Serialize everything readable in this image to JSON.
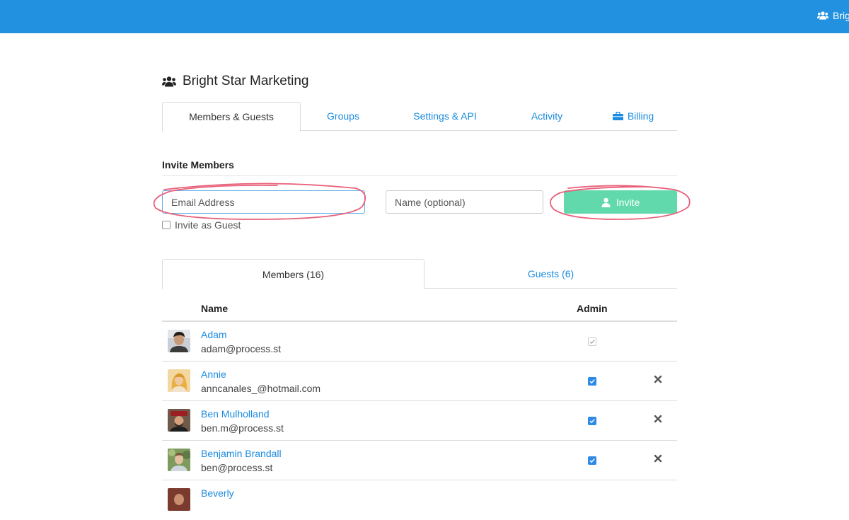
{
  "topbar": {
    "org_label": "Brig",
    "icon": "users-icon"
  },
  "org": {
    "title": "Bright Star Marketing",
    "icon": "users-icon"
  },
  "tabs": [
    {
      "label": "Members & Guests",
      "active": true
    },
    {
      "label": "Groups"
    },
    {
      "label": "Settings & API"
    },
    {
      "label": "Activity"
    },
    {
      "label": "Billing",
      "icon": "briefcase-icon"
    }
  ],
  "invite": {
    "title": "Invite Members",
    "email_placeholder": "Email Address",
    "name_placeholder": "Name (optional)",
    "button_label": "Invite",
    "button_icon": "user-icon",
    "guest_label": "Invite as Guest"
  },
  "subtabs": [
    {
      "label": "Members (16)",
      "active": true
    },
    {
      "label": "Guests (6)"
    }
  ],
  "table": {
    "headers": {
      "name": "Name",
      "admin": "Admin"
    },
    "rows": [
      {
        "name": "Adam",
        "email": "adam@process.st",
        "admin": true,
        "admin_disabled": true,
        "removable": false
      },
      {
        "name": "Annie",
        "email": "anncanales_@hotmail.com",
        "admin": true,
        "removable": true
      },
      {
        "name": "Ben Mulholland",
        "email": "ben.m@process.st",
        "admin": true,
        "removable": true
      },
      {
        "name": "Benjamin Brandall",
        "email": "ben@process.st",
        "admin": true,
        "removable": true
      },
      {
        "name": "Beverly",
        "email": "",
        "admin": true,
        "removable": true
      }
    ]
  },
  "colors": {
    "topbar": "#2191e0",
    "link": "#1a8be0",
    "invite_button": "#62d9ad",
    "annotation": "#e8607a"
  }
}
